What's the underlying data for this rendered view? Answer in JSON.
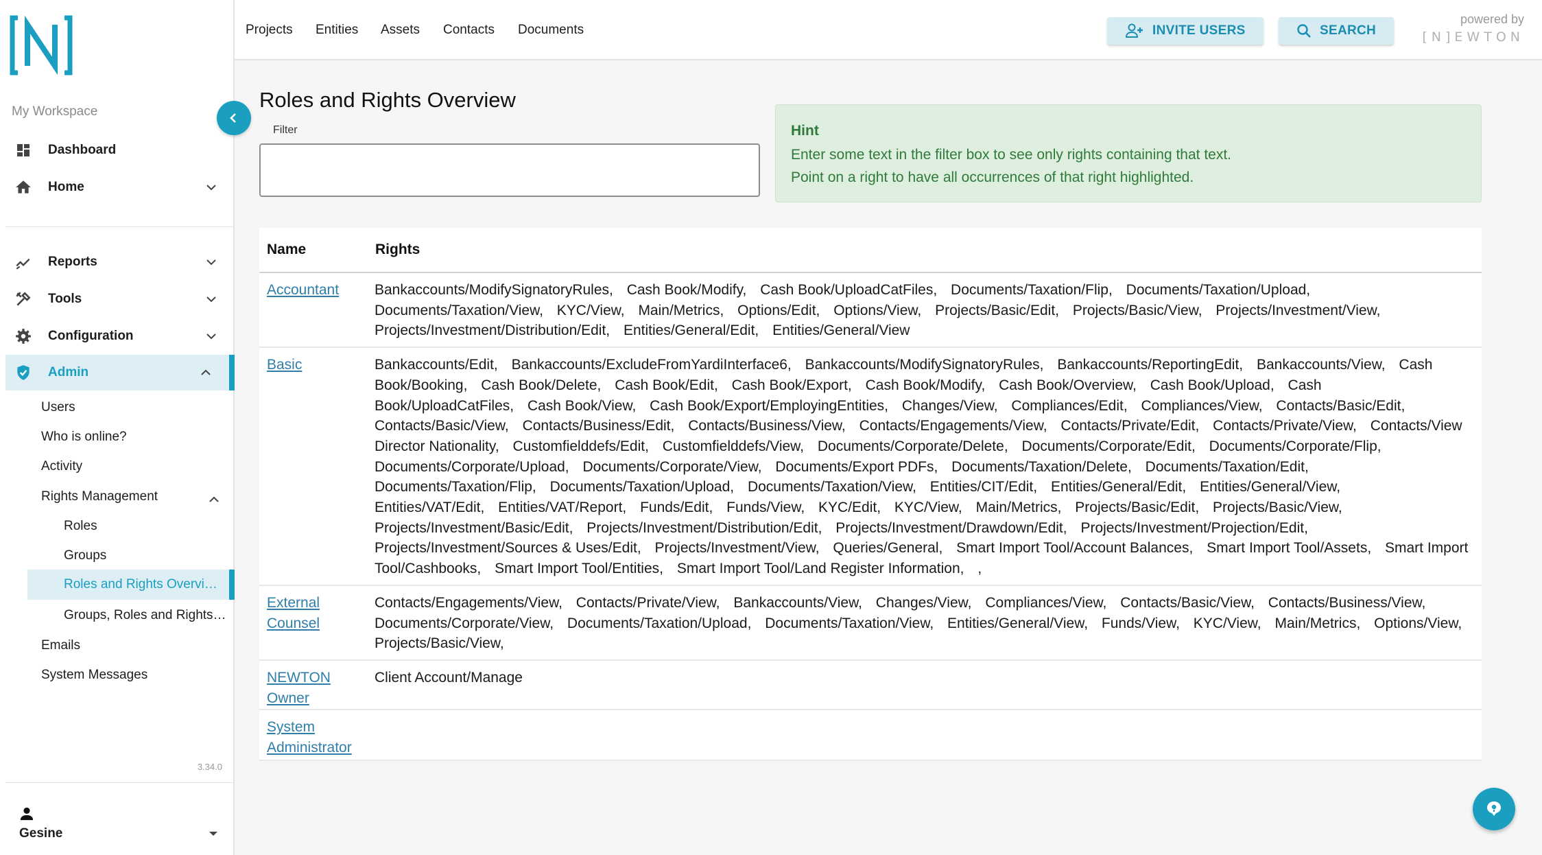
{
  "app": {
    "logo_text": "[N]",
    "workspace_label": "My Workspace",
    "version": "3.34.0",
    "accent": "#1a9fc0"
  },
  "sidebar": {
    "items": [
      {
        "label": "Dashboard",
        "icon": "dashboard-icon"
      },
      {
        "label": "Home",
        "icon": "home-icon"
      },
      {
        "label": "Reports",
        "icon": "trending-icon"
      },
      {
        "label": "Tools",
        "icon": "tools-icon"
      },
      {
        "label": "Configuration",
        "icon": "gear-icon"
      },
      {
        "label": "Admin",
        "icon": "shield-check-icon"
      }
    ],
    "admin_sub": [
      "Users",
      "Who is online?",
      "Activity",
      "Rights Management"
    ],
    "rights_sub": [
      "Roles",
      "Groups",
      "Roles and Rights Overvi…",
      "Groups, Roles and Rights…"
    ],
    "admin_tail": [
      "Emails",
      "System Messages"
    ],
    "user_name": "Gesine"
  },
  "topbar": {
    "nav": [
      "Projects",
      "Entities",
      "Assets",
      "Contacts",
      "Documents"
    ],
    "invite_label": "INVITE USERS",
    "search_label": "SEARCH",
    "powered_by": "powered by",
    "powered_logo": "[N]EWTON"
  },
  "main": {
    "title": "Roles and Rights Overview",
    "filter_label": "Filter",
    "filter_value": "",
    "hint": {
      "title": "Hint",
      "line1": "Enter some text in the filter box to see only rights containing that text.",
      "line2": "Point on a right to have all occurrences of that right highlighted."
    },
    "table": {
      "headers": [
        "Name",
        "Rights"
      ],
      "rows": [
        {
          "name": "Accountant",
          "rights": [
            "Bankaccounts/ModifySignatoryRules,",
            "Cash Book/Modify,",
            "Cash Book/UploadCatFiles,",
            "Documents/Taxation/Flip,",
            "Documents/Taxation/Upload,",
            "Documents/Taxation/View,",
            "KYC/View,",
            "Main/Metrics,",
            "Options/Edit,",
            "Options/View,",
            "Projects/Basic/Edit,",
            "Projects/Basic/View,",
            "Projects/Investment/View,",
            "Projects/Investment/Distribution/Edit,",
            "Entities/General/Edit,",
            "Entities/General/View"
          ]
        },
        {
          "name": "Basic",
          "rights": [
            "Bankaccounts/Edit,",
            "Bankaccounts/ExcludeFromYardiInterface6,",
            "Bankaccounts/ModifySignatoryRules,",
            "Bankaccounts/ReportingEdit,",
            "Bankaccounts/View,",
            "Cash Book/Booking,",
            "Cash Book/Delete,",
            "Cash Book/Edit,",
            "Cash Book/Export,",
            "Cash Book/Modify,",
            "Cash Book/Overview,",
            "Cash Book/Upload,",
            "Cash Book/UploadCatFiles,",
            "Cash Book/View,",
            "Cash Book/Export/EmployingEntities,",
            "Changes/View,",
            "Compliances/Edit,",
            "Compliances/View,",
            "Contacts/Basic/Edit,",
            "Contacts/Basic/View,",
            "Contacts/Business/Edit,",
            "Contacts/Business/View,",
            "Contacts/Engagements/View,",
            "Contacts/Private/Edit,",
            "Contacts/Private/View,",
            "Contacts/View Director Nationality,",
            "Customfielddefs/Edit,",
            "Customfielddefs/View,",
            "Documents/Corporate/Delete,",
            "Documents/Corporate/Edit,",
            "Documents/Corporate/Flip,",
            "Documents/Corporate/Upload,",
            "Documents/Corporate/View,",
            "Documents/Export PDFs,",
            "Documents/Taxation/Delete,",
            "Documents/Taxation/Edit,",
            "Documents/Taxation/Flip,",
            "Documents/Taxation/Upload,",
            "Documents/Taxation/View,",
            "Entities/CIT/Edit,",
            "Entities/General/Edit,",
            "Entities/General/View,",
            "Entities/VAT/Edit,",
            "Entities/VAT/Report,",
            "Funds/Edit,",
            "Funds/View,",
            "KYC/Edit,",
            "KYC/View,",
            "Main/Metrics,",
            "Projects/Basic/Edit,",
            "Projects/Basic/View,",
            "Projects/Investment/Basic/Edit,",
            "Projects/Investment/Distribution/Edit,",
            "Projects/Investment/Drawdown/Edit,",
            "Projects/Investment/Projection/Edit,",
            "Projects/Investment/Sources & Uses/Edit,",
            "Projects/Investment/View,",
            "Queries/General,",
            "Smart Import Tool/Account Balances,",
            "Smart Import Tool/Assets,",
            "Smart Import Tool/Cashbooks,",
            "Smart Import Tool/Entities,",
            "Smart Import Tool/Land Register Information,",
            ","
          ]
        },
        {
          "name": "External Counsel",
          "rights": [
            "Contacts/Engagements/View,",
            "Contacts/Private/View,",
            "Bankaccounts/View,",
            "Changes/View,",
            "Compliances/View,",
            "Contacts/Basic/View,",
            "Contacts/Business/View,",
            "Documents/Corporate/View,",
            "Documents/Taxation/Upload,",
            "Documents/Taxation/View,",
            "Entities/General/View,",
            "Funds/View,",
            "KYC/View,",
            "Main/Metrics,",
            "Options/View,",
            "Projects/Basic/View,"
          ]
        },
        {
          "name": "NEWTON Owner",
          "rights": [
            "Client Account/Manage"
          ]
        },
        {
          "name": "System Administrator",
          "rights": []
        }
      ]
    }
  }
}
